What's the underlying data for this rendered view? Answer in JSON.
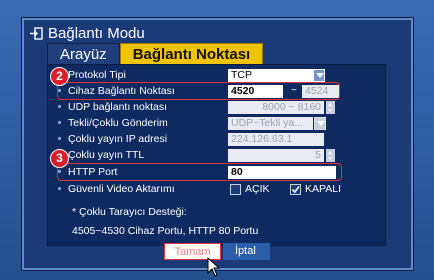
{
  "window": {
    "title": "Bağlantı Modu",
    "title_icon": "enter-icon"
  },
  "tabs": [
    {
      "label": "Arayüz",
      "active": false
    },
    {
      "label": "Bağlantı Noktası",
      "active": true
    }
  ],
  "callouts": {
    "badge_2": "2",
    "badge_3": "3"
  },
  "rows": {
    "protocol": {
      "label": "Protokol Tipi",
      "value": "TCP"
    },
    "device_port": {
      "label": "Cihaz Bağlantı Noktası",
      "from": "4520",
      "sep": "~",
      "to": "4524"
    },
    "udp_port": {
      "label": "UDP bağlantı noktası",
      "value": "8000 ~ 8160"
    },
    "multicast": {
      "label": "Tekli/Çoklu Gönderim",
      "value": "UDP~Tekli ya..."
    },
    "multicast_ip": {
      "label": "Çoklu yayın IP adresi",
      "value": "224.126.63.1"
    },
    "multicast_ttl": {
      "label": "Çoklu yayın TTL",
      "value": "5"
    },
    "http_port": {
      "label": "HTTP Port",
      "value": "80"
    },
    "secure_video": {
      "label": "Güvenli Video Aktarımı",
      "opt_on": "AÇIK",
      "opt_off": "KAPALI",
      "selected": "KAPALI"
    }
  },
  "notes": {
    "line1": "* Çoklu Tarayıcı Desteği:",
    "line2": "4505~4530 Cihaz Portu, HTTP 80 Portu"
  },
  "buttons": {
    "ok": "Tamam",
    "cancel": "İptal"
  },
  "colors": {
    "accent": "#f0c400",
    "highlight": "#e0303a",
    "panel": "#0f2a61"
  }
}
